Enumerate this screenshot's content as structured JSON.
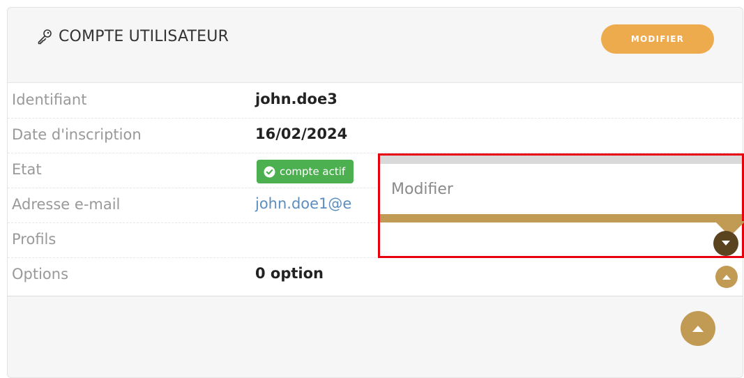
{
  "header": {
    "title": "COMPTE UTILISATEUR",
    "title_icon": "key-icon",
    "modify_button": "MODIFIER"
  },
  "rows": [
    {
      "label": "Identifiant",
      "value": "john.doe3"
    },
    {
      "label": "Date d'inscription",
      "value": "16/02/2024"
    },
    {
      "label": "Etat",
      "value": "compte actif",
      "badge_icon": "check-circle-icon"
    },
    {
      "label": "Adresse e-mail",
      "value": "john.doe1@e"
    },
    {
      "label": "Profils",
      "value": ""
    },
    {
      "label": "Options",
      "value": "0 option"
    }
  ],
  "popup": {
    "label": "Modifier"
  },
  "colors": {
    "accent": "#eeab4e",
    "gold": "#c19a54",
    "dark_brown": "#5a4420",
    "badge_green": "#4caf50",
    "highlight_red": "#e8000d",
    "link_blue": "#5b8dc0"
  }
}
